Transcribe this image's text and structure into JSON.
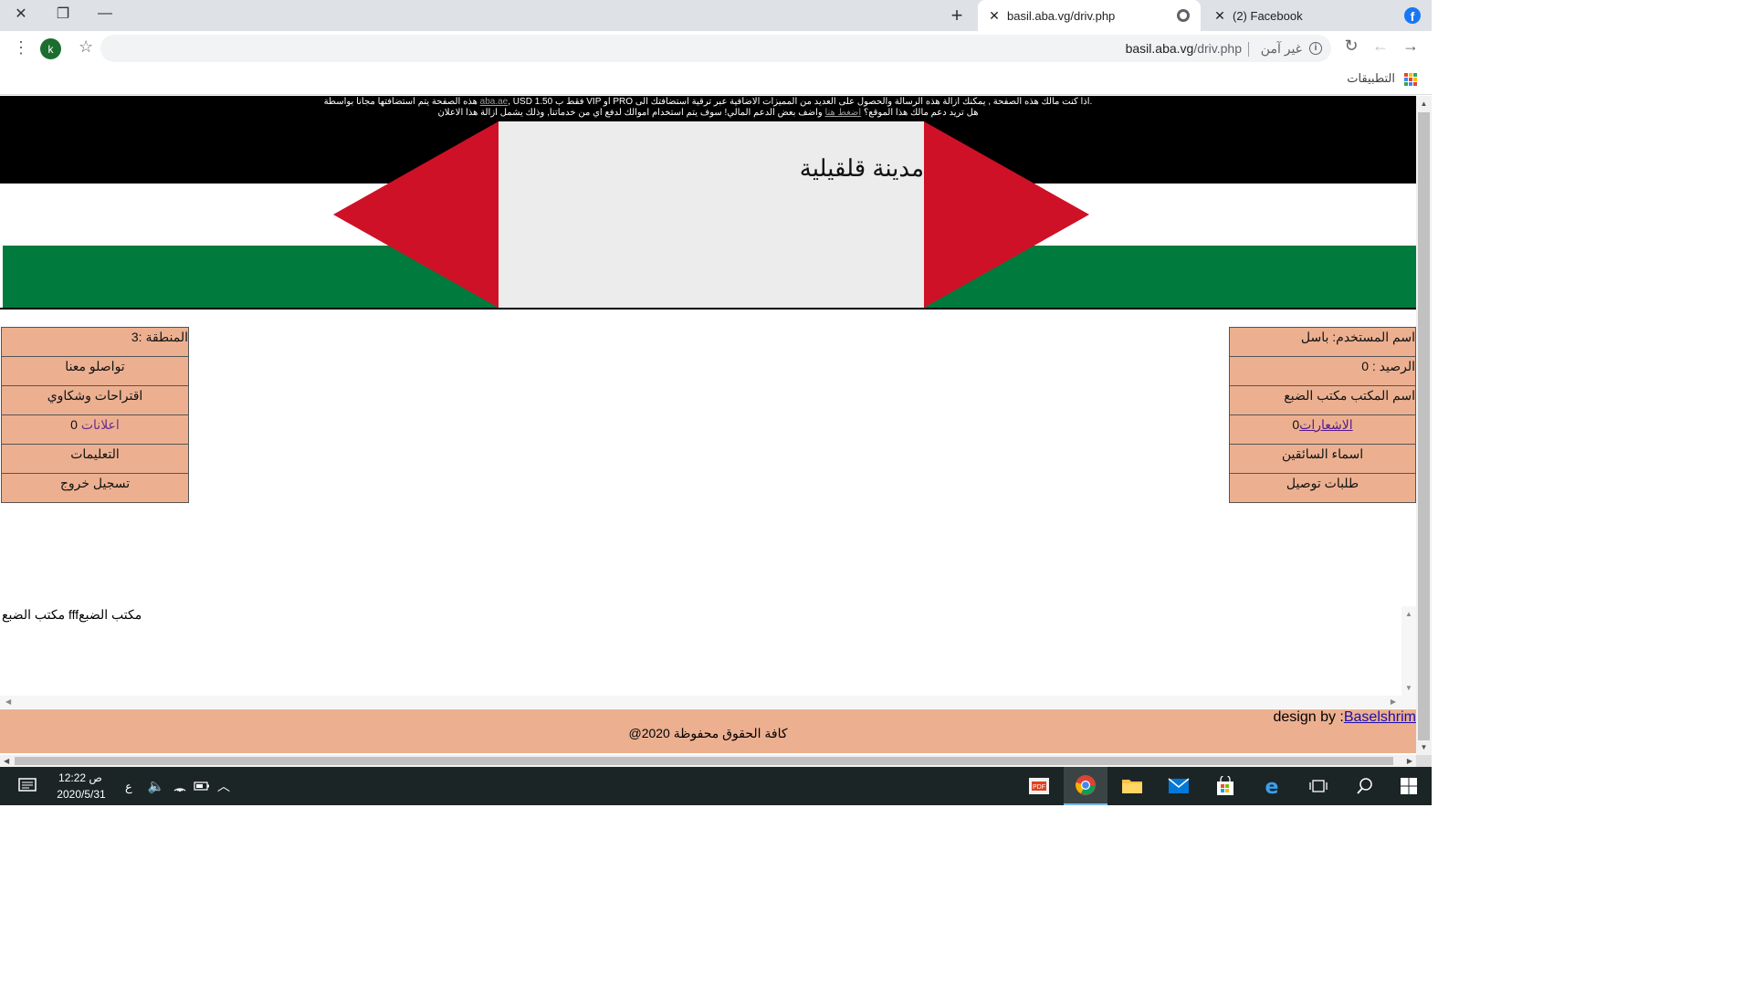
{
  "browser": {
    "tabs": [
      {
        "title": "basil.aba.vg/driv.php",
        "active": true
      },
      {
        "title": "(2) Facebook",
        "active": false
      }
    ],
    "address": {
      "host": "basil.aba.vg",
      "path": "/driv.php",
      "security_label": "غير آمن"
    },
    "profile_initial": "k",
    "bookmarks": {
      "apps_label": "التطبيقات"
    }
  },
  "page": {
    "ad_banner": {
      "line1": "USD فقط ب 1.50 VIP او PRO اذا كنت مالك هذه الصفحة , يمكنك ازالة هذه الرسالة والحصول على العديد من المميزات الاضافية عبر ترقية استضافتك الى.",
      "line1_link": "aba.ae",
      "line1_tail": "هذه الصفحة يتم استضافتها مجانا بواسطة",
      "line2_start": "هل تريد دعم مالك هذا الموقع؟",
      "line2_link": "اضغط هنا",
      "line2_end": "واضف بعض الدعم المالي! سوف يتم استخدام اموالك لدفع اي من خدماتنا, وذلك يشمل ازالة هذا الاعلان"
    },
    "title": "مدينة قلقيلية",
    "left_menu": {
      "region": "المنطقة :3",
      "contact": "تواصلو معنا",
      "suggestions": "اقتراحات وشكاوي",
      "ads_label": "اعلانات",
      "ads_count": "0",
      "instructions": "التعليمات",
      "logout": "تسجيل خروج"
    },
    "right_menu": {
      "username": "اسم المستخدم: باسل",
      "balance": "الرصيد : 0",
      "office_name": "اسم المكتب مكتب الضبع",
      "notifications_label": " الاشعارات",
      "notifications_count": "0",
      "drivers": "اسماء السائقين",
      "delivery_requests": "طلبات توصيل"
    },
    "office_text": "مكتب الضبع fffمكتب الضبع",
    "footer": {
      "design_prefix": "design by :",
      "designer": "Baselshrim",
      "copyright": "كافة الحقوق محفوظة 2020@"
    },
    "colors": {
      "flag_black": "#000000",
      "flag_green": "#007a3d",
      "flag_red": "#ce1126",
      "panel": "#ecb091"
    }
  },
  "taskbar": {
    "time": "12:22",
    "ampm": "ص",
    "date": "2020/5/31",
    "language": "ع"
  }
}
